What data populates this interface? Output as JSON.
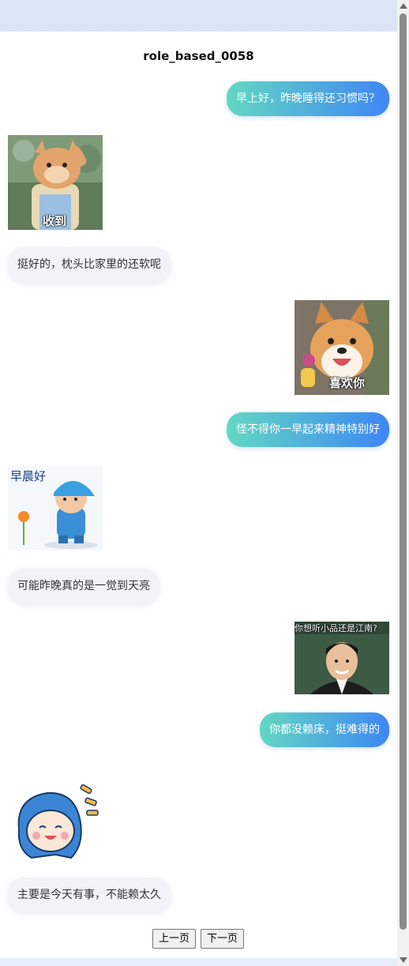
{
  "title": "role_based_0058",
  "messages": [
    {
      "side": "right",
      "type": "text",
      "text": "早上好，昨晚睡得还习惯吗？"
    },
    {
      "side": "left",
      "type": "sticker",
      "caption": "收到"
    },
    {
      "side": "left",
      "type": "text",
      "text": "挺好的，枕头比家里的还软呢"
    },
    {
      "side": "right",
      "type": "sticker",
      "caption": "喜欢你"
    },
    {
      "side": "right",
      "type": "text",
      "text": "怪不得你一早起来精神特别好"
    },
    {
      "side": "left",
      "type": "sticker",
      "caption": "早晨好"
    },
    {
      "side": "left",
      "type": "text",
      "text": "可能昨晚真的是一觉到天亮"
    },
    {
      "side": "right",
      "type": "sticker",
      "caption": "你想听小品还是江南?"
    },
    {
      "side": "right",
      "type": "text",
      "text": "你都没赖床，挺难得的"
    },
    {
      "side": "left",
      "type": "sticker",
      "caption": ""
    },
    {
      "side": "left",
      "type": "text",
      "text": "主要是今天有事，不能赖太久"
    }
  ],
  "pager": {
    "prev": "上一页",
    "next": "下一页"
  },
  "colors": {
    "bubble_gradient_start": "#62d8c2",
    "bubble_gradient_end": "#3f86f5",
    "left_bubble": "#f1f3f7"
  }
}
